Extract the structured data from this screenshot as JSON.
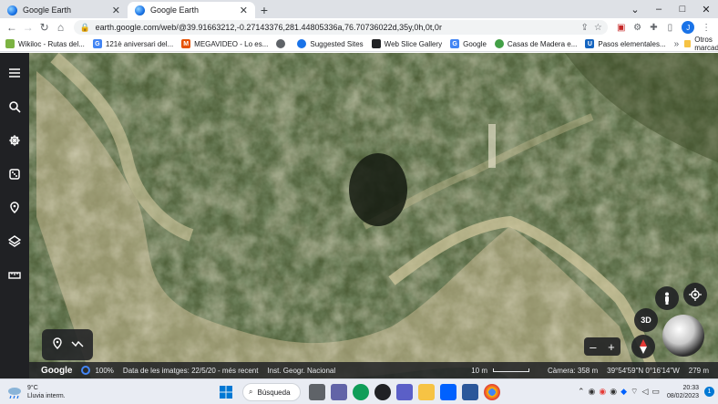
{
  "browser": {
    "tabs": [
      {
        "title": "Google Earth",
        "active": false
      },
      {
        "title": "Google Earth",
        "active": true
      }
    ],
    "new_tab": "+",
    "window_controls": {
      "minimize": "–",
      "maximize": "□",
      "close": "✕",
      "collapse": "⌄"
    },
    "url": "earth.google.com/web/@39.91663212,-0.27143376,281.44805336a,76.70736022d,35y,0h,0t,0r",
    "profile_initial": "J",
    "bookmarks": [
      {
        "label": "Wikiloc - Rutas del...",
        "color": "#7cb342"
      },
      {
        "label": "121è aniversari del...",
        "color": "#4285f4"
      },
      {
        "label": "MEGAVIDEO - Lo es...",
        "color": "#e65100"
      },
      {
        "label": "",
        "color": "#5f6368"
      },
      {
        "label": "Suggested Sites",
        "color": "#1a73e8"
      },
      {
        "label": "Web Slice Gallery",
        "color": "#202124"
      },
      {
        "label": "Google",
        "color": "#4285f4"
      },
      {
        "label": "Casas de Madera e...",
        "color": "#43a047"
      },
      {
        "label": "Pasos elementales...",
        "color": "#1565c0"
      }
    ],
    "bookmarks_more": "»",
    "other_bookmarks": "Otros marcadores"
  },
  "earth": {
    "zoom_in": "+",
    "zoom_out": "–",
    "three_d_label": "3D",
    "status": {
      "logo": "Google",
      "loading_pct": "100%",
      "imagery_date": "Data de les imatges: 22/5/20 - més recent",
      "attribution": "Inst. Geogr. Nacional",
      "scale": "10 m",
      "camera": "Càmera: 358 m",
      "coords": "39°54'59\"N 0°16'14\"W",
      "elevation": "279 m"
    }
  },
  "taskbar": {
    "weather_temp": "9°C",
    "weather_desc": "Lluvia interm.",
    "search_label": "Búsqueda",
    "time": "20:33",
    "date": "08/02/2023",
    "notif_count": "1"
  }
}
